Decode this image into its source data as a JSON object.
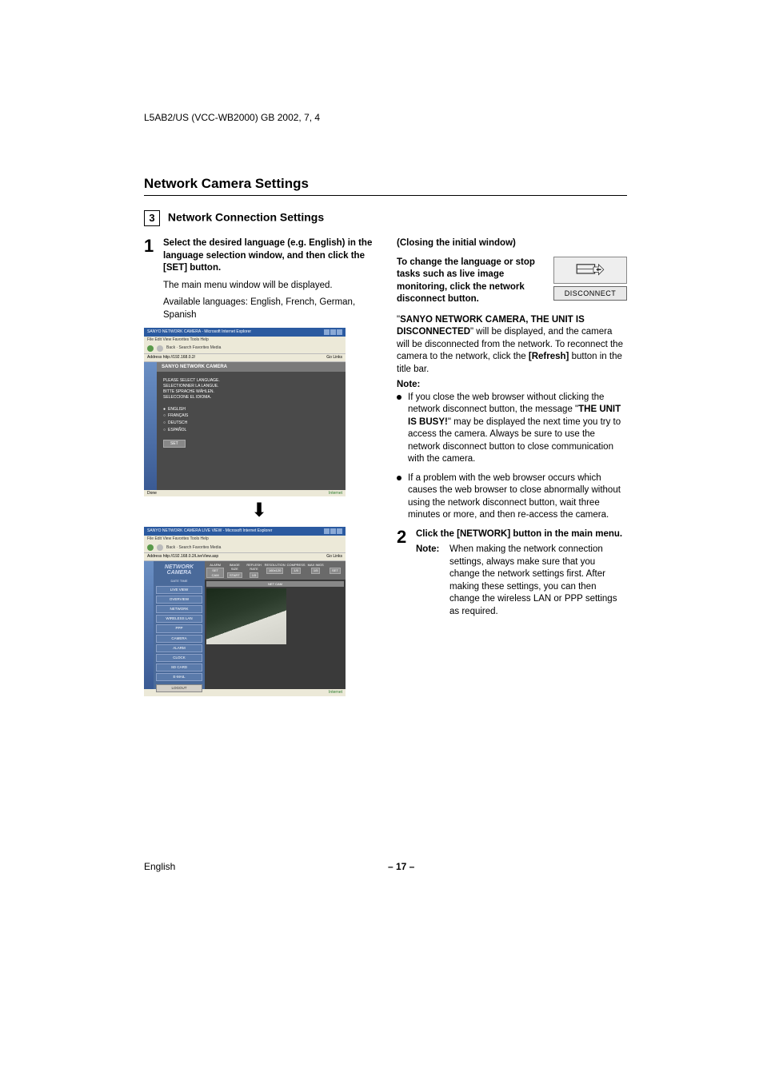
{
  "header": "L5AB2/US (VCC-WB2000)   GB   2002, 7, 4",
  "title": "Network Camera Settings",
  "section_number": "3",
  "subtitle": "Network Connection Settings",
  "left": {
    "step1_num": "1",
    "step1_bold": "Select the desired language (e.g. English) in the language selection window, and then click the [SET] button.",
    "step1_line1": "The main menu window will be displayed.",
    "step1_line2": "Available languages: English, French, German, Spanish",
    "ss1": {
      "title": "SANYO NETWORK CAMERA - Microsoft Internet Explorer",
      "menu": "File   Edit   View   Favorites   Tools   Help",
      "toolbar": "Back  ·       Search   Favorites   Media",
      "addr": "Address  http://192.168.0.2/",
      "go": "Go   Links",
      "heading": "SANYO NETWORK CAMERA",
      "lang1": "PLEASE SELECT LANGUAGE.",
      "lang2": "SELECTIONNER LA LANGUE.",
      "lang3": "BITTE SPRACHE WÄHLEN.",
      "lang4": "SELECCIONE EL IDIOMA.",
      "opt1": "ENGLISH",
      "opt2": "FRANÇAIS",
      "opt3": "DEUTSCH",
      "opt4": "ESPAÑOL",
      "set": "SET",
      "status_l": "Done",
      "status_r": "Internet"
    },
    "ss2": {
      "title": "SANYO NETWORK CAMERA LIVE VIEW - Microsoft Internet Explorer",
      "menu": "File   Edit   View   Favorites   Tools   Help",
      "addr": "Address  http://192.168.0.2/LiveView.asp",
      "go": "Go   Links",
      "logo1": "NETWORK",
      "logo2": "CAMERA",
      "date": "DATE   TIME",
      "menu_items": [
        "LIVE VIEW",
        "OVERVIEW",
        "NETWORK",
        "WIRELESS LAN",
        "PPP",
        "CAMERA",
        "ALARM",
        "CLOCK",
        "SD CARD",
        "E-MAIL"
      ],
      "logout": "LOGOUT",
      "ctl_alarm_l": "ALARM",
      "ctl_alarm_v": "SET CAM",
      "ctl_imgsz_l": "IMAGE SIZE",
      "ctl_imgsz_v": "START",
      "ctl_rate_l": "REFLESH RATE",
      "ctl_rate_v": "1/5",
      "ctl_res_l": "RESOLUTION",
      "ctl_res_v": "160x120",
      "ctl_comp_l": "COMPRESS",
      "ctl_comp_v": "1/5",
      "ctl_max_l": "MAX IMGS",
      "ctl_max_v": "1/5",
      "ctl_set": "SET",
      "cam_label": "NET CAM",
      "status_r": "Internet"
    }
  },
  "right": {
    "closing_h": "(Closing the initial window)",
    "closing_p": "To change the language or stop tasks such as live image monitoring, click the network disconnect button.",
    "disc_btn": "DISCONNECT",
    "para2_pre": "\"",
    "para2_bold": "SANYO NETWORK CAMERA, THE UNIT IS DISCONNECTED",
    "para2_post": "\" will be displayed, and the camera will be disconnected from the network. To reconnect the camera to the network, click the ",
    "para2_refresh": "[Refresh]",
    "para2_end": " button in the title bar.",
    "note": "Note:",
    "b1_pre": "If you close the web browser without clicking the network disconnect button, the message \"",
    "b1_bold": "THE UNIT IS BUSY!",
    "b1_post": "\" may be displayed the next time you try to access the camera. Always be sure to use the network disconnect button to close communication with the camera.",
    "b2": "If a problem with the web browser occurs which causes the web browser to close abnormally without using the network disconnect button, wait three minutes or more, and then re-access the camera.",
    "step2_num": "2",
    "step2_bold": "Click the [NETWORK] button in the main menu.",
    "step2_note_h": "Note:",
    "step2_note_body": "When making the network connection settings, always make sure that you change the network settings first. After making these settings, you can then change the wireless LAN or PPP settings as required."
  },
  "footer": {
    "left": "English",
    "center": "– 17 –"
  }
}
